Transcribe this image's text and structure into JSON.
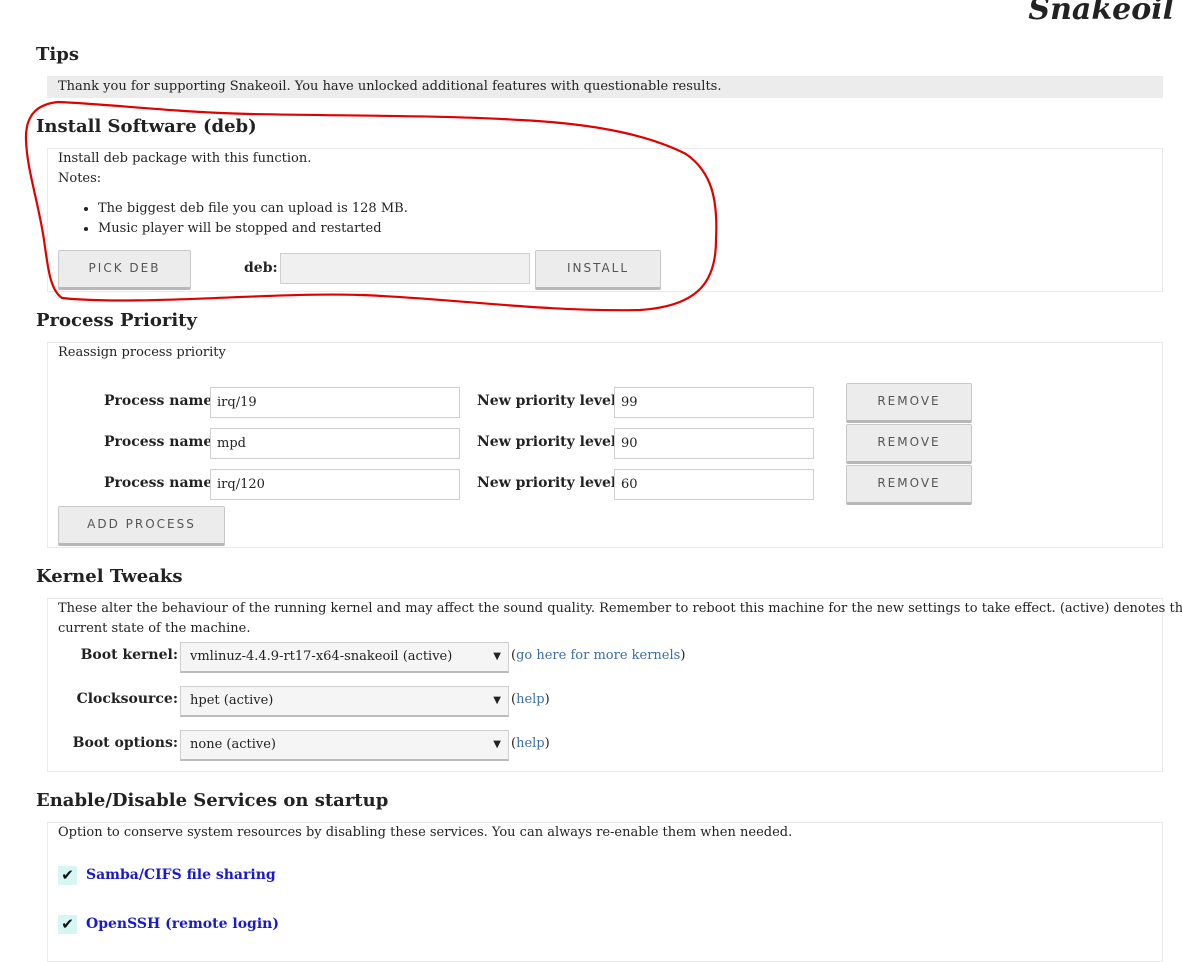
{
  "brand": "Snakeoil",
  "tips": {
    "title": "Tips",
    "message": "Thank you for supporting Snakeoil. You have unlocked additional features with questionable results."
  },
  "install": {
    "title": "Install Software (deb)",
    "description": "Install deb package with this function.",
    "notes_label": "Notes:",
    "notes": [
      "The biggest deb file you can upload is 128 MB.",
      "Music player will be stopped and restarted"
    ],
    "pick_label": "PICK DEB",
    "field_label": "deb:",
    "field_value": "",
    "install_label": "INSTALL"
  },
  "priority": {
    "title": "Process Priority",
    "description": "Reassign process priority",
    "process_label": "Process name:",
    "level_label": "New priority level:",
    "remove_label": "REMOVE",
    "rows": [
      {
        "process": "irq/19",
        "level": "99"
      },
      {
        "process": "mpd",
        "level": "90"
      },
      {
        "process": "irq/120",
        "level": "60"
      }
    ],
    "add_label": "ADD PROCESS"
  },
  "kernel": {
    "title": "Kernel Tweaks",
    "description_line1": "These alter the behaviour of the running kernel and may affect the sound quality. Remember to reboot this machine for the new settings to take effect. (active) denotes the",
    "description_line2": "current state of the machine.",
    "rows": [
      {
        "label": "Boot kernel:",
        "value": "vmlinuz-4.4.9-rt17-x64-snakeoil (active)",
        "link": "go here for more kernels"
      },
      {
        "label": "Clocksource:",
        "value": "hpet (active)",
        "link": "help"
      },
      {
        "label": "Boot options:",
        "value": "none (active)",
        "link": "help"
      }
    ]
  },
  "services": {
    "title": "Enable/Disable Services on startup",
    "description": "Option to conserve system resources by disabling these services. You can always re-enable them when needed.",
    "items": [
      {
        "label": "Samba/CIFS file sharing",
        "checked": true
      },
      {
        "label": "OpenSSH (remote login)",
        "checked": true
      }
    ]
  },
  "colors": {
    "annotation": "#e00000",
    "link": "#3a6ea8",
    "service_link": "#1a1ac8",
    "checkbox_bg": "#d6f5f5"
  },
  "icons": {
    "checkbox": "checkmark-icon",
    "select_arrow": "triangle-down-icon"
  }
}
